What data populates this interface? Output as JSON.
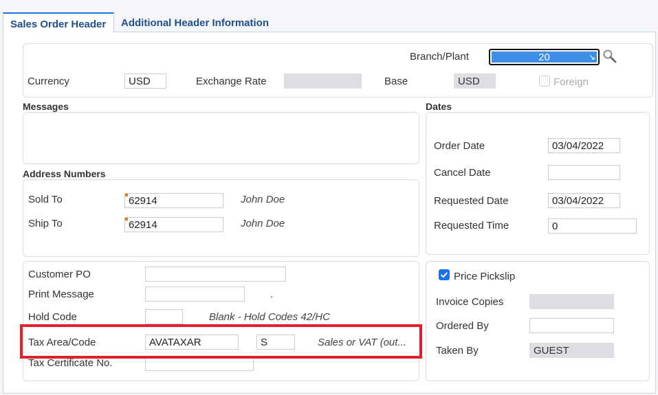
{
  "tabs": [
    {
      "label": "Sales Order Header"
    },
    {
      "label": "Additional Header Information"
    }
  ],
  "header": {
    "branch_plant_label": "Branch/Plant",
    "branch_plant_value": "20",
    "currency_label": "Currency",
    "currency_value": "USD",
    "exchange_rate_label": "Exchange Rate",
    "exchange_rate_value": "",
    "base_label": "Base",
    "base_value": "USD",
    "foreign_label": "Foreign"
  },
  "messages": {
    "title": "Messages"
  },
  "dates": {
    "title": "Dates",
    "order_date_label": "Order Date",
    "order_date_value": "03/04/2022",
    "cancel_date_label": "Cancel Date",
    "cancel_date_value": "",
    "requested_date_label": "Requested Date",
    "requested_date_value": "03/04/2022",
    "requested_time_label": "Requested Time",
    "requested_time_value": "0"
  },
  "address": {
    "title": "Address Numbers",
    "sold_to_label": "Sold To",
    "sold_to_value": "62914",
    "sold_to_name": "John Doe",
    "ship_to_label": "Ship To",
    "ship_to_value": "62914",
    "ship_to_name": "John Doe"
  },
  "order_info": {
    "customer_po_label": "Customer PO",
    "customer_po_value": "",
    "print_message_label": "Print Message",
    "print_message_value": "",
    "print_message_desc": ".",
    "hold_code_label": "Hold Code",
    "hold_code_value": "",
    "hold_code_desc": "Blank - Hold Codes 42/HC",
    "tax_area_label": "Tax Area/Code",
    "tax_area_value": "AVATAXAR",
    "tax_code_value": "S",
    "tax_code_desc": "Sales or VAT (out...",
    "tax_cert_label": "Tax Certificate No.",
    "tax_cert_value": ""
  },
  "picking": {
    "price_pickslip_label": "Price Pickslip",
    "invoice_copies_label": "Invoice Copies",
    "invoice_copies_value": "",
    "ordered_by_label": "Ordered By",
    "ordered_by_value": "",
    "taken_by_label": "Taken By",
    "taken_by_value": "GUEST"
  },
  "colors": {
    "accent": "#1e6fd9",
    "highlight": "#e0202a",
    "required": "#e8781d"
  }
}
